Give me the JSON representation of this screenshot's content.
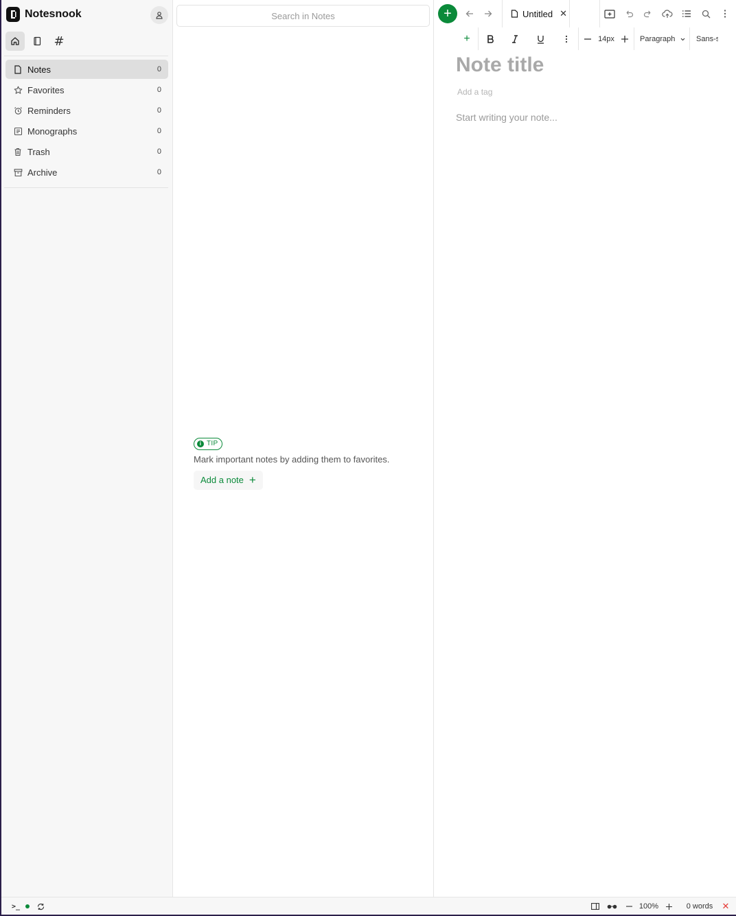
{
  "app": {
    "name": "Notesnook"
  },
  "sidebar": {
    "tabs": [
      {
        "name": "home-icon"
      },
      {
        "name": "notebook-icon"
      },
      {
        "name": "tags-icon",
        "glyph": "#"
      }
    ],
    "items": [
      {
        "label": "Notes",
        "count": "0",
        "icon": "note-icon",
        "active": true
      },
      {
        "label": "Favorites",
        "count": "0",
        "icon": "star-icon"
      },
      {
        "label": "Reminders",
        "count": "0",
        "icon": "alarm-icon"
      },
      {
        "label": "Monographs",
        "count": "0",
        "icon": "monograph-icon"
      },
      {
        "label": "Trash",
        "count": "0",
        "icon": "trash-icon"
      },
      {
        "label": "Archive",
        "count": "0",
        "icon": "archive-icon"
      }
    ]
  },
  "list": {
    "search_placeholder": "Search in Notes",
    "tip": {
      "badge": "TIP",
      "text": "Mark important notes by adding them to favorites.",
      "button": "Add a note"
    }
  },
  "editor": {
    "tab_title": "Untitled",
    "toolbar": {
      "font_size": "14px",
      "block_type": "Paragraph",
      "font_family": "Sans-s"
    },
    "title_placeholder": "Note title",
    "tag_placeholder": "Add a tag",
    "body_placeholder": "Start writing your note..."
  },
  "status": {
    "zoom": "100%",
    "word_count": "0 words"
  },
  "colors": {
    "accent": "#0b8a3a",
    "error": "#e53935"
  }
}
